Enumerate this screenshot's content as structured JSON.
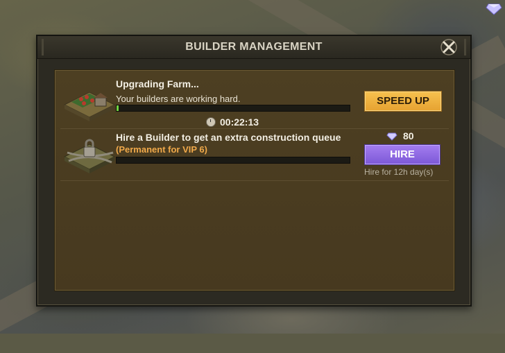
{
  "dialog": {
    "title": "BUILDER MANAGEMENT"
  },
  "queue_upgrade": {
    "title": "Upgrading Farm...",
    "subtitle": "Your builders are working hard.",
    "progress": 0.01,
    "timer": "00:22:13",
    "action_label": "SPEED UP"
  },
  "queue_hire": {
    "title": "Hire a Builder to get an extra construction queue",
    "vip_note": "(Permanent for VIP 6)",
    "cost": "80",
    "action_label": "HIRE",
    "duration_note": "Hire for 12h day(s)"
  },
  "colors": {
    "speed_up": "#f2b440",
    "hire": "#8e69e4",
    "progress_fill": "#6fd341",
    "vip_text": "#f0a94a"
  },
  "icons": {
    "close": "close-icon",
    "clock": "clock-icon",
    "gem": "gem-icon",
    "corner": "gem-icon"
  }
}
